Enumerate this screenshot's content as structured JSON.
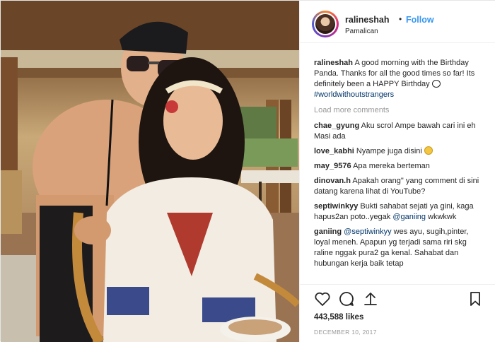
{
  "post": {
    "username": "ralineshah",
    "dot": "•",
    "follow_label": "Follow",
    "location": "Pamalican",
    "caption": {
      "user": "ralineshah",
      "text": "A good morning with the Birthday Panda. Thanks for all the good times so far! Its definitely been a HAPPY Birthday",
      "hashtag": "#worldwithoutstrangers"
    },
    "load_more": "Load more comments",
    "comments": [
      {
        "user": "chae_gyung",
        "text": "Aku scrol Ampe bawah cari ini eh Masi ada"
      },
      {
        "user": "love_kabhi",
        "text": "Nyampe juga disini",
        "emoji": "grimace-emoji"
      },
      {
        "user": "may_9576",
        "text": "Apa mereka berteman"
      },
      {
        "user": "dinovan.h",
        "text": "Apakah orang\" yang comment di sini datang karena lihat di YouTube?"
      },
      {
        "user": "septiwinkyy",
        "text": "Bukti sahabat sejati ya gini, kaga hapus2an poto..yegak",
        "mention": "@ganiing",
        "trail": "wkwkwk"
      },
      {
        "user": "ganiing",
        "mention": "@septiwinkyy",
        "text": "wes ayu, sugih,pinter, loyal meneh. Apapun yg terjadi sama riri skg raline nggak pura2 ga kenal. Sahabat dan hubungan kerja baik tetap"
      }
    ],
    "likes": "443,588 likes",
    "date": "DECEMBER 10, 2017"
  },
  "icons": [
    "heart-icon",
    "comment-icon",
    "share-icon",
    "bookmark-icon"
  ],
  "colors": {
    "link": "#3897f0",
    "hashtag": "#003569",
    "muted": "#999999",
    "border": "#efefef"
  }
}
